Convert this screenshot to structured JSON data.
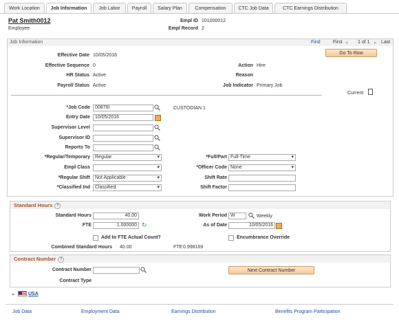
{
  "tabs": [
    {
      "label": "Work Location",
      "active": false
    },
    {
      "label": "Job Information",
      "active": true
    },
    {
      "label": "Job Labor",
      "active": false
    },
    {
      "label": "Payroll",
      "active": false
    },
    {
      "label": "Salary Plan",
      "active": false
    },
    {
      "label": "Compensation",
      "active": false
    },
    {
      "label": "CTC Job Data",
      "active": false
    },
    {
      "label": "CTC Earnings Distribution",
      "active": false
    }
  ],
  "header": {
    "name": "Pat Smith0012",
    "role": "Employee",
    "empl_id_label": "Empl ID",
    "empl_id": "101000012",
    "empl_record_label": "Empl Record",
    "empl_record": "2"
  },
  "job_info": {
    "title": "Job Information",
    "find": "Find",
    "first": "First",
    "pager": "1 of 1",
    "last": "Last",
    "go_to_row": "Go To Row",
    "effective_date_label": "Effective Date",
    "effective_date": "10/05/2016",
    "effective_seq_label": "Effective Sequence",
    "effective_seq": "0",
    "action_label": "Action",
    "action": "Hire",
    "hr_status_label": "HR Status",
    "hr_status": "Active",
    "reason_label": "Reason",
    "reason": "",
    "payroll_status_label": "Payroll Status",
    "payroll_status": "Active",
    "job_indicator_label": "Job Indicator",
    "job_indicator": "Primary Job",
    "current": "Current"
  },
  "form": {
    "job_code_label": "*Job Code",
    "job_code": "00876I",
    "job_code_desc": "CUSTODIAN 1",
    "entry_date_label": "Entry Date",
    "entry_date": "10/05/2016",
    "supervisor_level_label": "Supervisor Level",
    "supervisor_id_label": "Supervisor ID",
    "reports_to_label": "Reports To",
    "reg_temp_label": "*Regular/Temporary",
    "reg_temp": "Regular",
    "full_part_label": "*Full/Part",
    "full_part": "Full-Time",
    "empl_class_label": "Empl Class",
    "empl_class": "",
    "officer_code_label": "*Officer Code",
    "officer_code": "None",
    "regular_shift_label": "*Regular Shift",
    "regular_shift": "Not Applicable",
    "shift_rate_label": "Shift Rate",
    "classified_label": "*Classified Ind",
    "classified": "Classified",
    "shift_factor_label": "Shift Factor"
  },
  "standard_hours": {
    "title": "Standard Hours",
    "std_hours_label": "Standard Hours",
    "std_hours": "40.00",
    "work_period_label": "Work Period",
    "work_period": "W",
    "work_period_desc": "Weekly",
    "fte_label": "FTE",
    "fte": "1.000000",
    "as_of_label": "As of Date",
    "as_of": "10/05/2016",
    "add_fte_label": "Add to FTE Actual Count?",
    "encumbrance_label": "Encumbrance Override",
    "combined_label": "Combined Standard Hours",
    "combined": "40.00",
    "fte2_label": "FTE",
    "fte2": "0.998169"
  },
  "contract": {
    "title": "Contract Number",
    "number_label": "Contract Number",
    "next_button": "Next Contract Number",
    "type_label": "Contract Type",
    "usa": "USA"
  },
  "footer_links": [
    "Job Data",
    "Employment Data",
    "Earnings Distribution",
    "Benefits Program Participation"
  ]
}
